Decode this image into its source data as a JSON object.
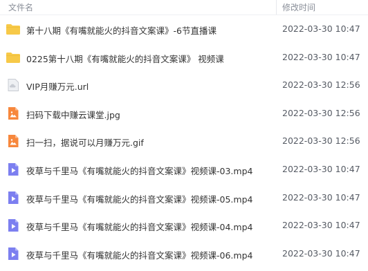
{
  "header": {
    "name_label": "文件名",
    "date_label": "修改时间"
  },
  "files": [
    {
      "name": "第十八期《有嘴就能火的抖音文案课》-6节直播课",
      "date": "2022-03-30 10:47",
      "icon": "folder-icon"
    },
    {
      "name": "0225第十八期《有嘴就能火的抖音文案课》 视频课",
      "date": "2022-03-30 10:47",
      "icon": "folder-icon"
    },
    {
      "name": "VIP月赚万元.url",
      "date": "2022-03-30 12:56",
      "icon": "cloud-file-icon"
    },
    {
      "name": "扫码下载中赚云课堂.jpg",
      "date": "2022-03-30 12:56",
      "icon": "image-file-icon"
    },
    {
      "name": "扫一扫，据说可以月赚万元.gif",
      "date": "2022-03-30 12:56",
      "icon": "image-file-icon"
    },
    {
      "name": "夜草与千里马《有嘴就能火的抖音文案课》视频课-03.mp4",
      "date": "2022-03-30 10:47",
      "icon": "video-file-icon"
    },
    {
      "name": "夜草与千里马《有嘴就能火的抖音文案课》视频课-05.mp4",
      "date": "2022-03-30 10:47",
      "icon": "video-file-icon"
    },
    {
      "name": "夜草与千里马《有嘴就能火的抖音文案课》视频课-04.mp4",
      "date": "2022-03-30 10:47",
      "icon": "video-file-icon"
    },
    {
      "name": "夜草与千里马《有嘴就能火的抖音文案课》视频课-06.mp4",
      "date": "2022-03-30 10:47",
      "icon": "video-file-icon"
    }
  ],
  "colors": {
    "folder": "#f7c948",
    "image_file": "#f7873c",
    "video_file": "#7c7ff0",
    "cloud_file": "#c8ccd3"
  }
}
